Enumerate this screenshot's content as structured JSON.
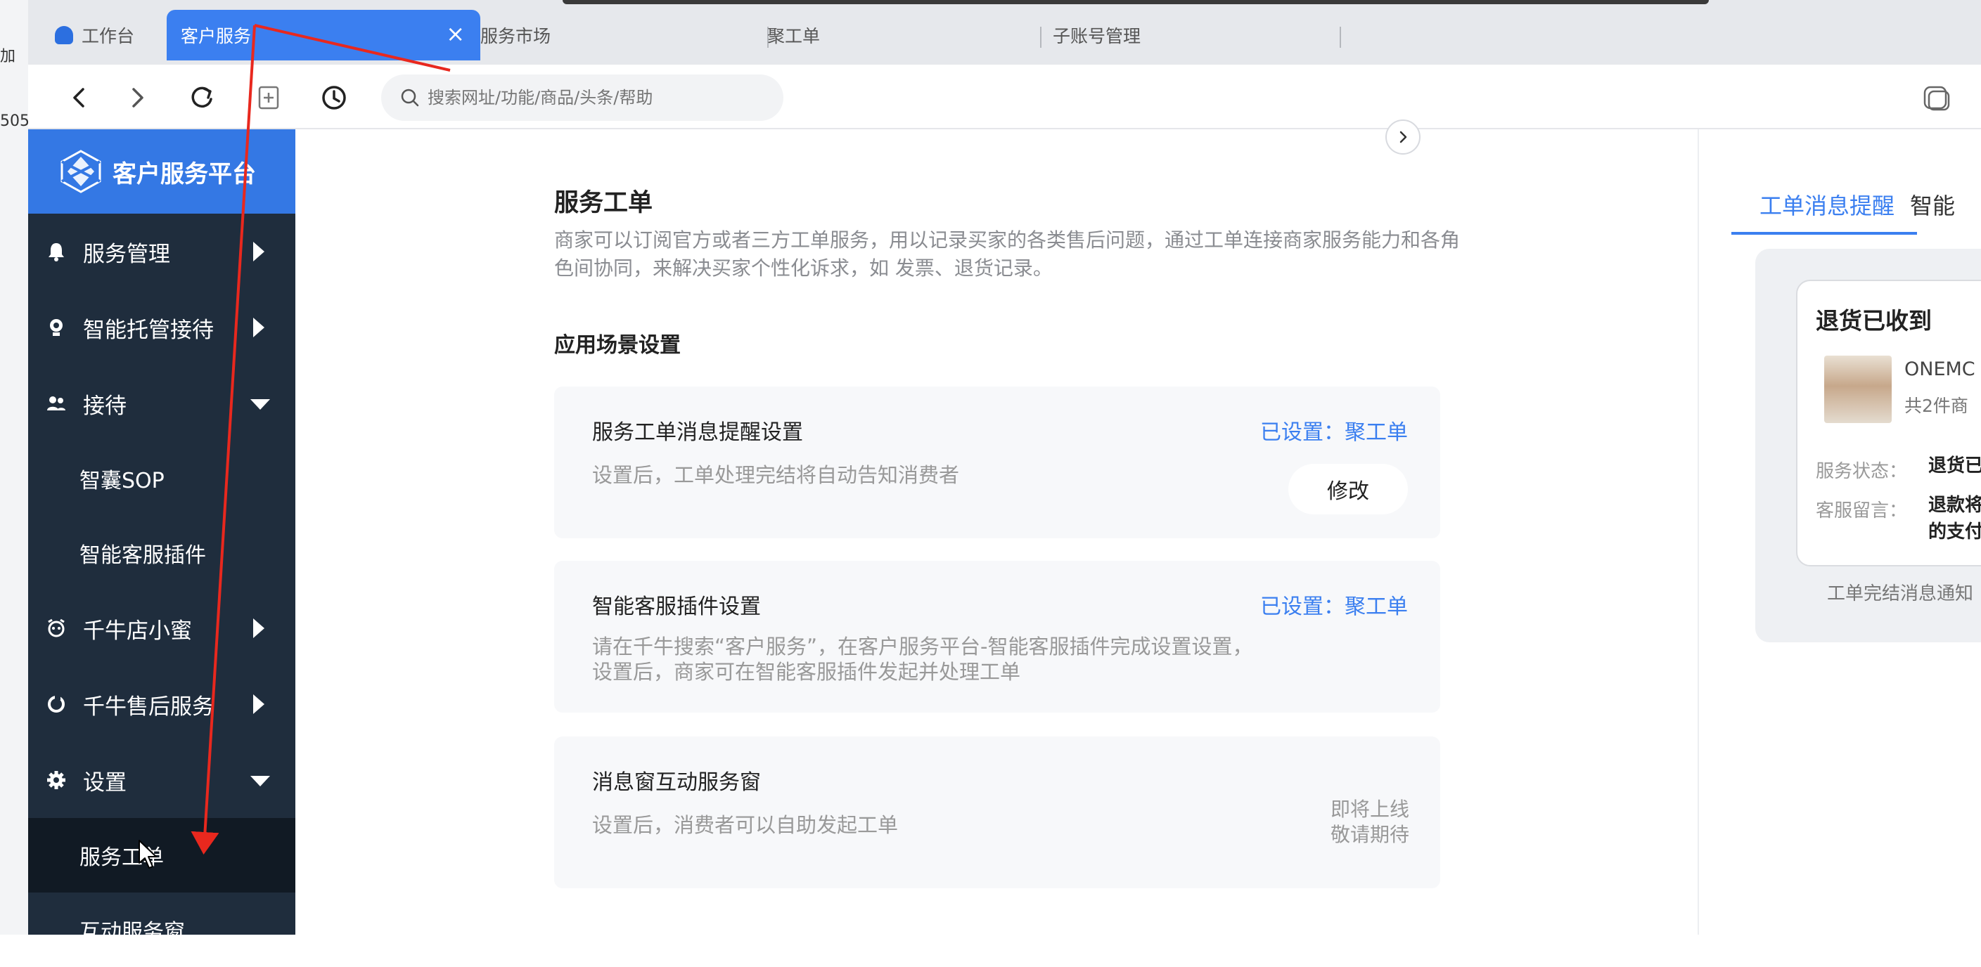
{
  "edge_fragments": [
    "加",
    "505"
  ],
  "tabs": [
    {
      "label": "工作台"
    },
    {
      "label": "客户服务",
      "close": "×"
    },
    {
      "label": "服务市场"
    },
    {
      "label": "聚工单"
    },
    {
      "label": "子账号管理"
    }
  ],
  "nav": {
    "search_placeholder": "搜索网址/功能/商品/头条/帮助"
  },
  "sidebar": {
    "brand": "客户服务平台",
    "items": [
      {
        "label": "服务管理"
      },
      {
        "label": "智能托管接待"
      },
      {
        "label": "接待"
      },
      {
        "label": "智囊SOP"
      },
      {
        "label": "智能客服插件"
      },
      {
        "label": "千牛店小蜜"
      },
      {
        "label": "千牛售后服务"
      },
      {
        "label": "设置"
      },
      {
        "label": "服务工单"
      },
      {
        "label": "互动服务窗"
      }
    ]
  },
  "main": {
    "title": "服务工单",
    "description": "商家可以订阅官方或者三方工单服务，用以记录买家的各类售后问题，通过工单连接商家服务能力和各角色间协同，来解决买家个性化诉求，如 发票、退货记录。",
    "section_title": "应用场景设置",
    "cards": [
      {
        "title": "服务工单消息提醒设置",
        "desc": "设置后，工单处理完结将自动告知消费者",
        "status": "已设置：聚工单",
        "button": "修改"
      },
      {
        "title": "智能客服插件设置",
        "desc": "请在千牛搜索“客户服务”，在客户服务平台-智能客服插件完成设置设置，设置后，商家可在智能客服插件发起并处理工单",
        "status": "已设置：聚工单"
      },
      {
        "title": "消息窗互动服务窗",
        "desc": "设置后，消费者可以自助发起工单",
        "soon_1": "即将上线",
        "soon_2": "敬请期待"
      }
    ]
  },
  "right_panel": {
    "tab_1": "工单消息提醒",
    "tab_2": "智能",
    "card": {
      "title": "退货已收到",
      "product_name": "ONEMC",
      "product_count": "共2件商",
      "status_label": "服务状态：",
      "status_value": "退货已",
      "note_label": "客服留言：",
      "note_value_1": "退款将",
      "note_value_2": "的支付"
    },
    "footer": "工单完结消息通知"
  },
  "colors": {
    "accent": "#3b7ff0",
    "sidebar_bg": "#1f2d3d",
    "sidebar_header": "#3478e4",
    "annotation": "#e8281e"
  }
}
